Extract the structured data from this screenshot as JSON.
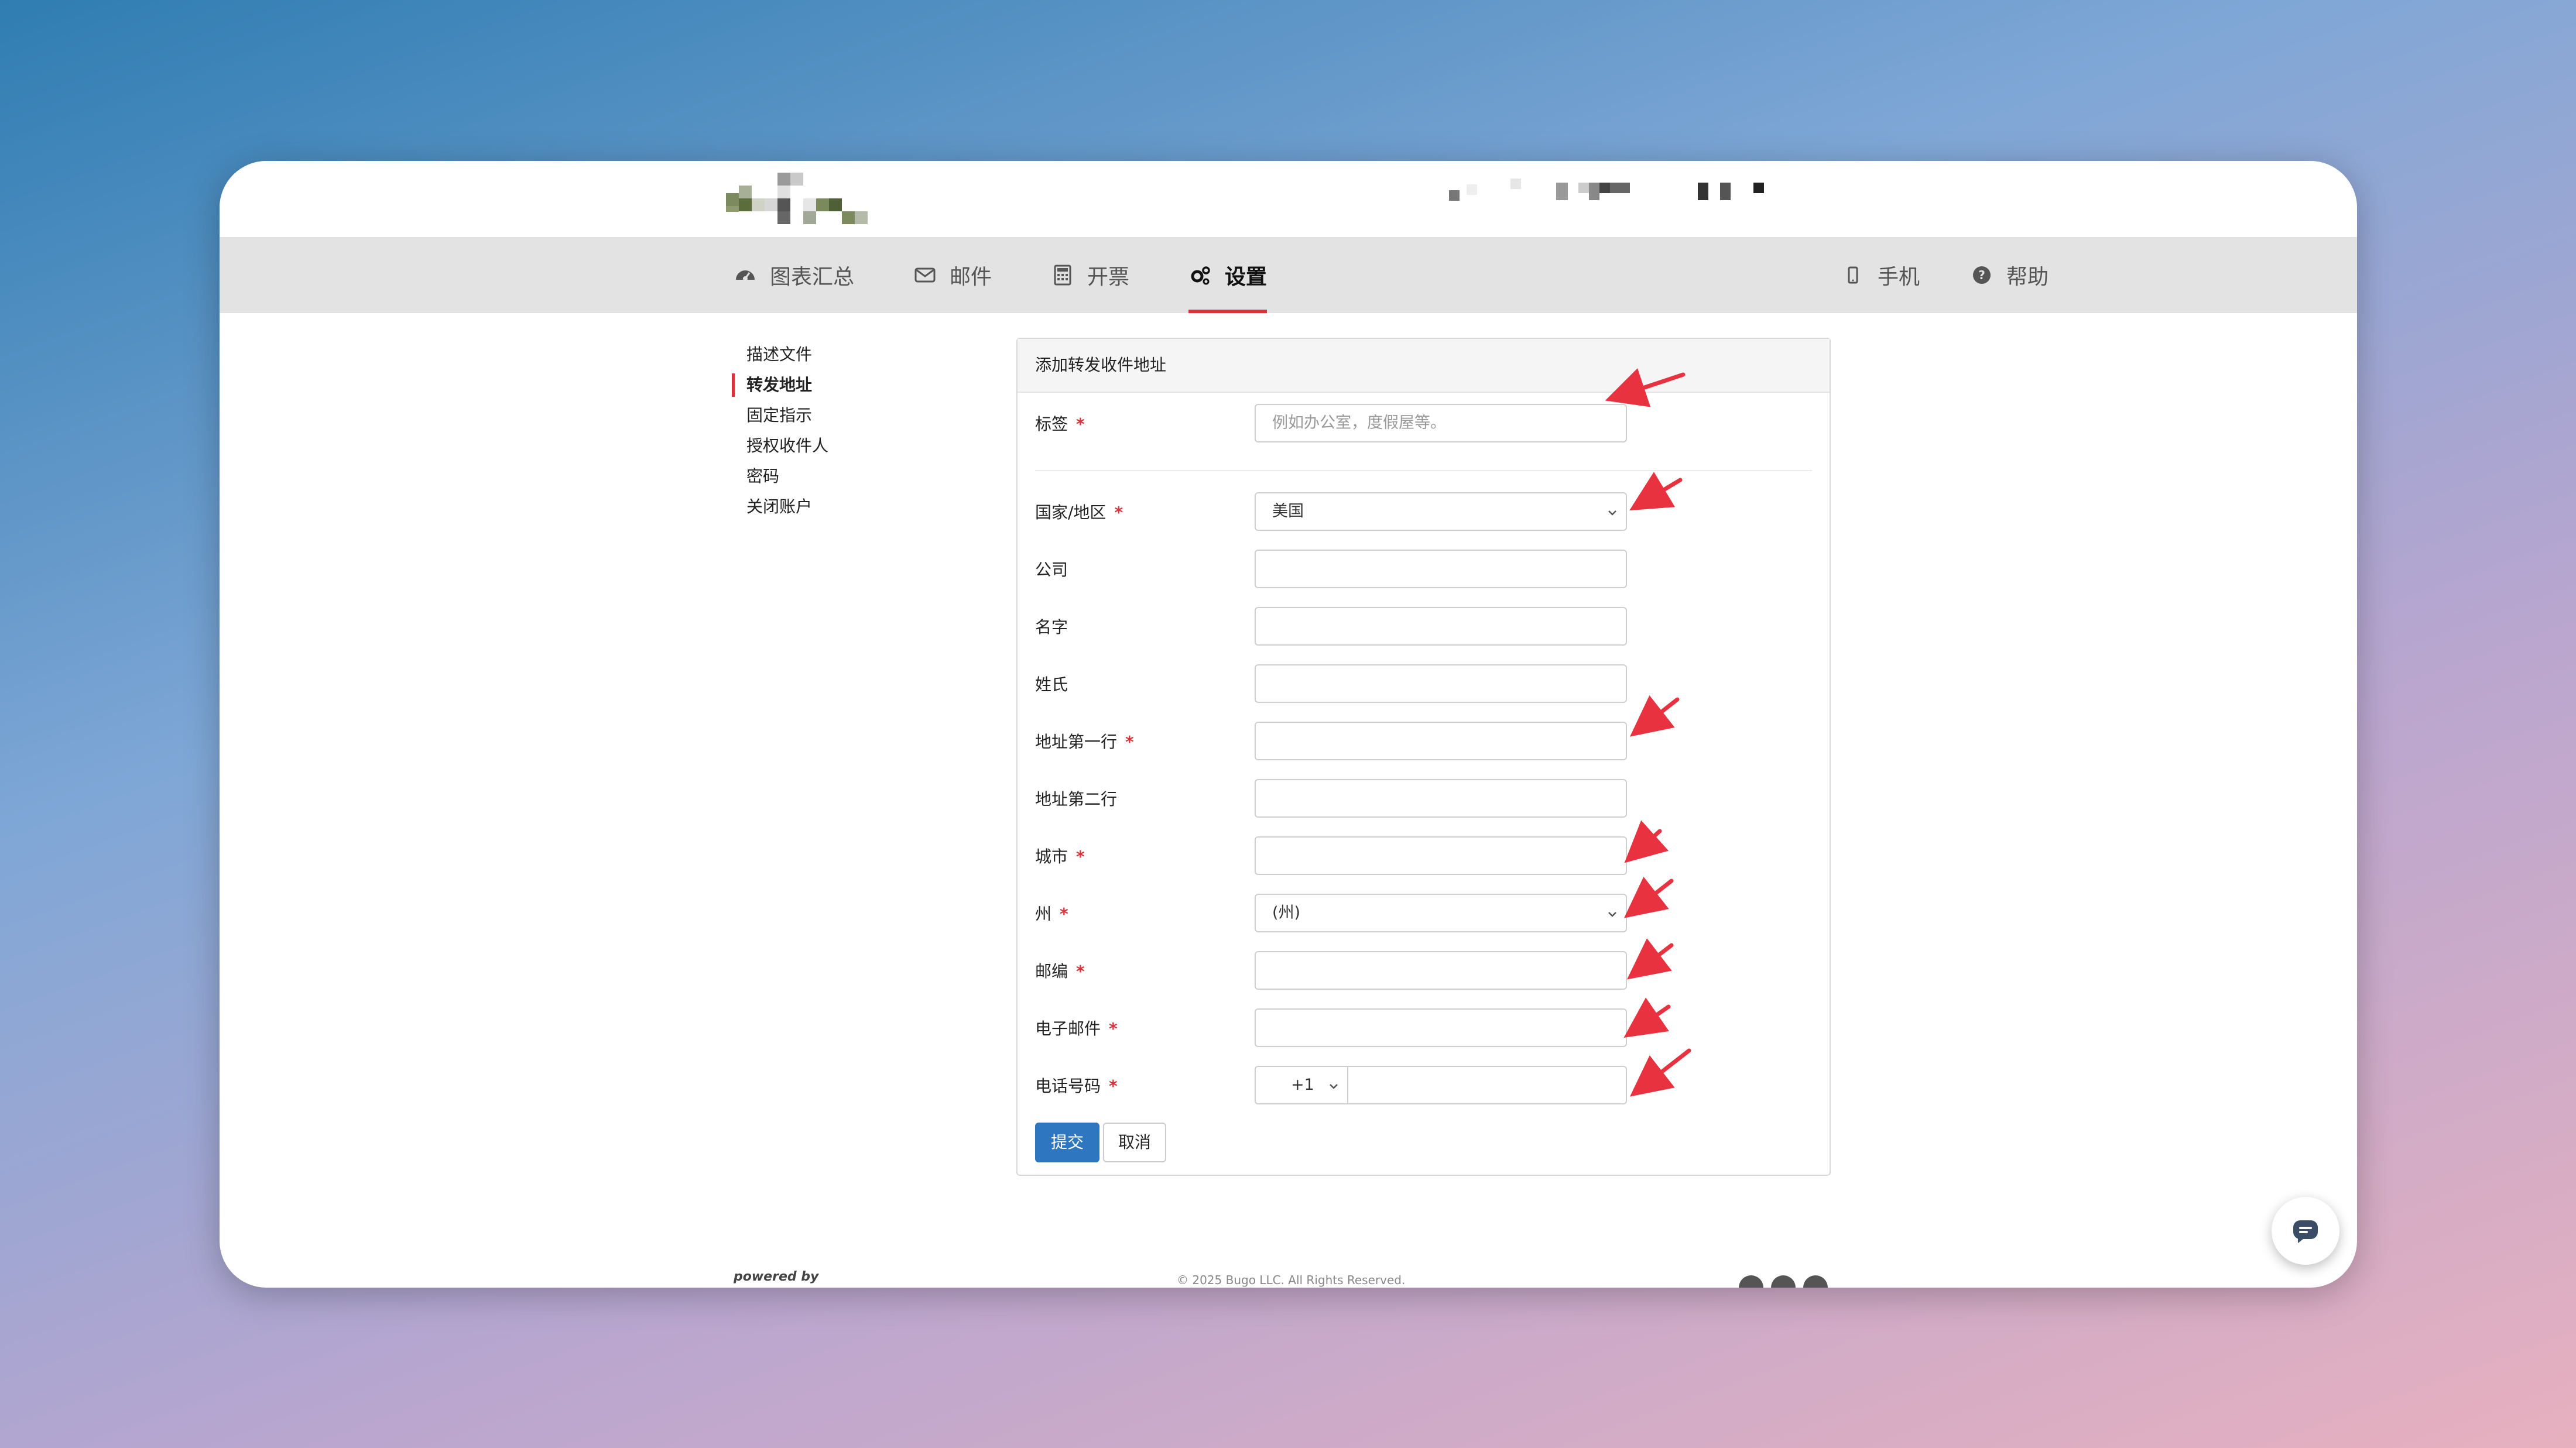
{
  "nav": {
    "items": [
      {
        "label": "图表汇总",
        "icon": "dashboard-icon"
      },
      {
        "label": "邮件",
        "icon": "mail-icon"
      },
      {
        "label": "开票",
        "icon": "calculator-icon"
      },
      {
        "label": "设置",
        "icon": "gears-icon",
        "active": true
      }
    ],
    "right": [
      {
        "label": "手机",
        "icon": "mobile-icon"
      },
      {
        "label": "帮助",
        "icon": "question-circle-icon"
      }
    ]
  },
  "sidebar": {
    "items": [
      {
        "label": "描述文件"
      },
      {
        "label": "转发地址",
        "active": true
      },
      {
        "label": "固定指示"
      },
      {
        "label": "授权收件人"
      },
      {
        "label": "密码"
      },
      {
        "label": "关闭账户"
      }
    ]
  },
  "form": {
    "title": "添加转发收件地址",
    "required_mark": "*",
    "label_field": {
      "label": "标签",
      "placeholder": "例如办公室，度假屋等。",
      "value": ""
    },
    "country": {
      "label": "国家/地区",
      "value": "美国"
    },
    "company": {
      "label": "公司",
      "value": ""
    },
    "first_name": {
      "label": "名字",
      "value": ""
    },
    "last_name": {
      "label": "姓氏",
      "value": ""
    },
    "address1": {
      "label": "地址第一行",
      "value": ""
    },
    "address2": {
      "label": "地址第二行",
      "value": ""
    },
    "city": {
      "label": "城市",
      "value": ""
    },
    "state": {
      "label": "州",
      "value": "(州)"
    },
    "zip": {
      "label": "邮编",
      "value": ""
    },
    "email": {
      "label": "电子邮件",
      "value": ""
    },
    "phone": {
      "label": "电话号码",
      "country_code": "+1",
      "value": ""
    },
    "submit_label": "提交",
    "cancel_label": "取消"
  },
  "footer": {
    "powered_by": "powered by",
    "copyright": "© 2025 Bugo LLC. All Rights Reserved."
  },
  "colors": {
    "accent": "#d9323a",
    "primary_button": "#2f76c0",
    "navbar_bg": "#e3e3e3",
    "annotation_arrow": "#e8323f"
  }
}
